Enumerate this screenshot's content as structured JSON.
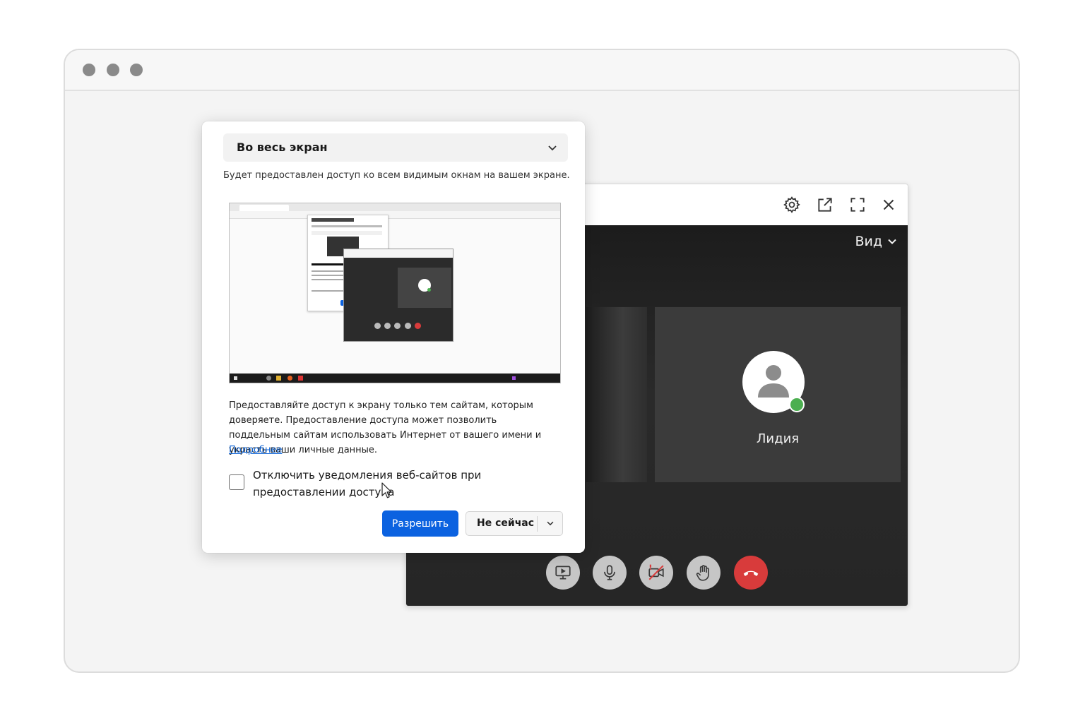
{
  "call": {
    "view_label": "Вид",
    "participant_name": "Лидия",
    "titlebar_icons": [
      "gear-icon",
      "popout-icon",
      "fullscreen-icon",
      "close-icon"
    ],
    "controls": [
      "screen-share-icon",
      "microphone-icon",
      "camera-off-icon",
      "raise-hand-icon",
      "hang-up-icon"
    ]
  },
  "dialog": {
    "source_selected": "Во весь экран",
    "source_description": "Будет предоставлен доступ ко всем видимым окнам на вашем экране.",
    "warning_text": "Предоставляйте доступ к экрану только тем сайтам, которым доверяете. Предоставление доступа может позволить поддельным сайтам использовать Интернет от вашего имени и украсть ваши личные данные.",
    "learn_more": "Подробнее",
    "checkbox_label": "Отключить уведомления веб-сайтов при предоставлении доступа",
    "checkbox_checked": false,
    "allow_button": "Разрешить",
    "not_now_button": "Не сейчас"
  },
  "colors": {
    "accent": "#0b62e0",
    "link": "#0b62d6",
    "status_online": "#4caf50",
    "hang_up": "#d83b3b"
  }
}
